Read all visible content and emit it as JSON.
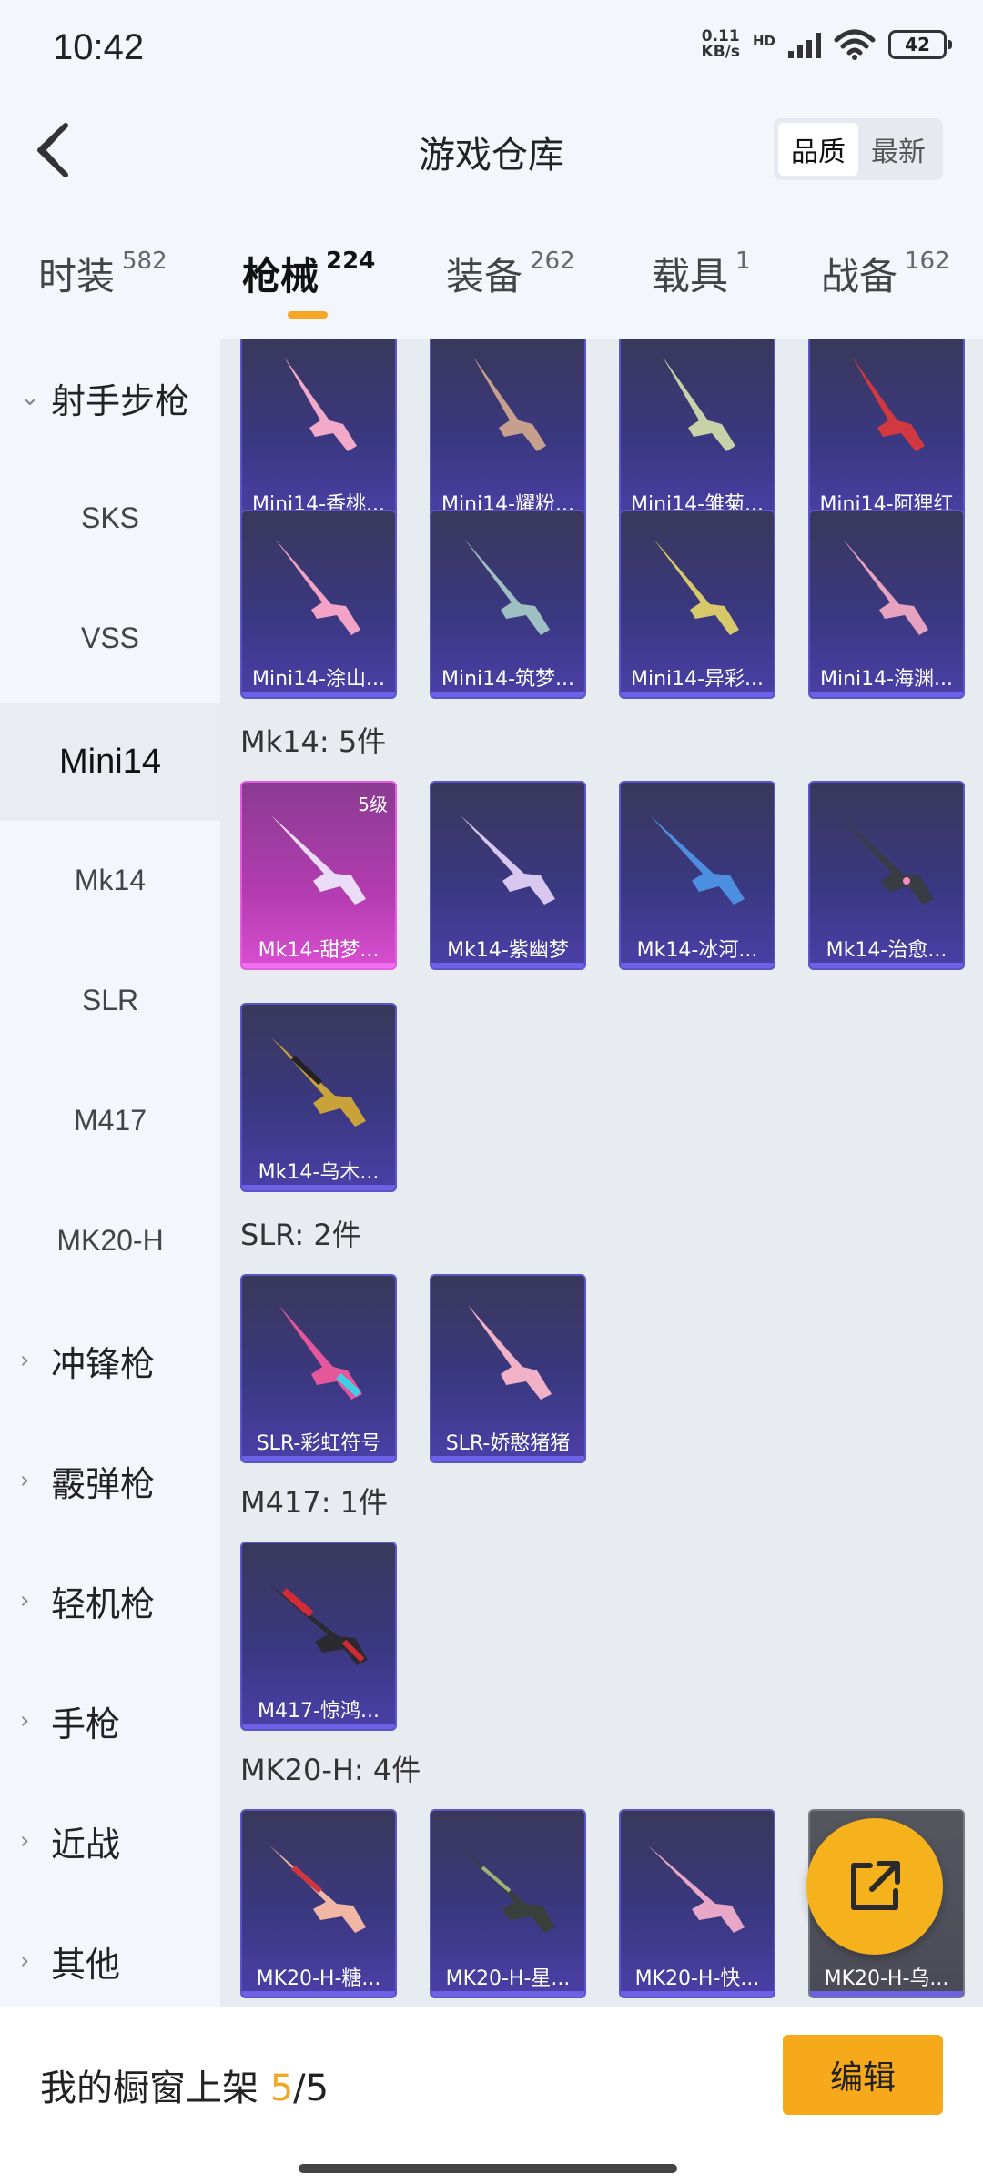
{
  "status": {
    "time": "10:42",
    "net_speed_value": "0.11",
    "net_speed_unit": "KB/s",
    "hd": "HD",
    "battery": "42"
  },
  "header": {
    "title": "游戏仓库",
    "sort": [
      "品质",
      "最新"
    ]
  },
  "tabs": [
    {
      "label": "时装",
      "count": "582"
    },
    {
      "label": "枪械",
      "count": "224"
    },
    {
      "label": "装备",
      "count": "262"
    },
    {
      "label": "载具",
      "count": "1"
    },
    {
      "label": "战备",
      "count": "162"
    }
  ],
  "sidebar": {
    "group_open": "射手步枪",
    "items": [
      "SKS",
      "VSS",
      "Mini14",
      "Mk14",
      "SLR",
      "M417",
      "MK20-H"
    ],
    "groups": [
      "冲锋枪",
      "霰弹枪",
      "轻机枪",
      "手枪",
      "近战",
      "其他"
    ]
  },
  "sections": {
    "mini14_row1": [
      "Mini14-香桃...",
      "Mini14-耀粉...",
      "Mini14-雏菊...",
      "Mini14-阿狸红"
    ],
    "mini14_row2": [
      "Mini14-涂山...",
      "Mini14-筑梦...",
      "Mini14-异彩...",
      "Mini14-海渊..."
    ],
    "mk14_title": "Mk14: 5件",
    "mk14": [
      "Mk14-甜梦...",
      "Mk14-紫幽梦",
      "Mk14-冰河...",
      "Mk14-治愈...",
      "Mk14-乌木..."
    ],
    "mk14_level": "5级",
    "slr_title": "SLR: 2件",
    "slr": [
      "SLR-彩虹符号",
      "SLR-娇憨猪猪"
    ],
    "m417_title": "M417: 1件",
    "m417": [
      "M417-惊鸿..."
    ],
    "mk20_title": "MK20-H: 4件",
    "mk20": [
      "MK20-H-糖...",
      "MK20-H-星...",
      "MK20-H-快...",
      "MK20-H-乌..."
    ]
  },
  "footer": {
    "label": "我的橱窗上架 ",
    "current": "5",
    "total": "/5",
    "edit": "编辑"
  }
}
